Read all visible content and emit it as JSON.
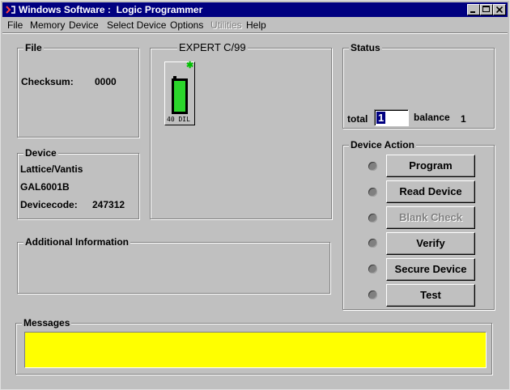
{
  "window": {
    "title": "Windows Software :  Logic Programmer"
  },
  "menu": [
    "File",
    "Memory",
    "Device",
    "Select Device",
    "Options",
    "Utilities",
    "Help"
  ],
  "file": {
    "label": "File",
    "checksum_label": "Checksum:",
    "checksum_value": "0000"
  },
  "programmer": {
    "label": "EXPERT  C/99",
    "socket_label": "40 DIL"
  },
  "status": {
    "label": "Status",
    "total_label": "total",
    "total_value": "1",
    "balance_label": "balance",
    "balance_value": "1"
  },
  "device": {
    "label": "Device",
    "manufacturer": "Lattice/Vantis",
    "part": "GAL6001B",
    "code_label": "Devicecode:",
    "code_value": "247312"
  },
  "device_action": {
    "label": "Device Action",
    "buttons": [
      "Program",
      "Read Device",
      "Blank Check",
      "Verify",
      "Secure Device",
      "Test"
    ]
  },
  "additional": {
    "label": "Additional Information"
  },
  "messages": {
    "label": "Messages"
  }
}
